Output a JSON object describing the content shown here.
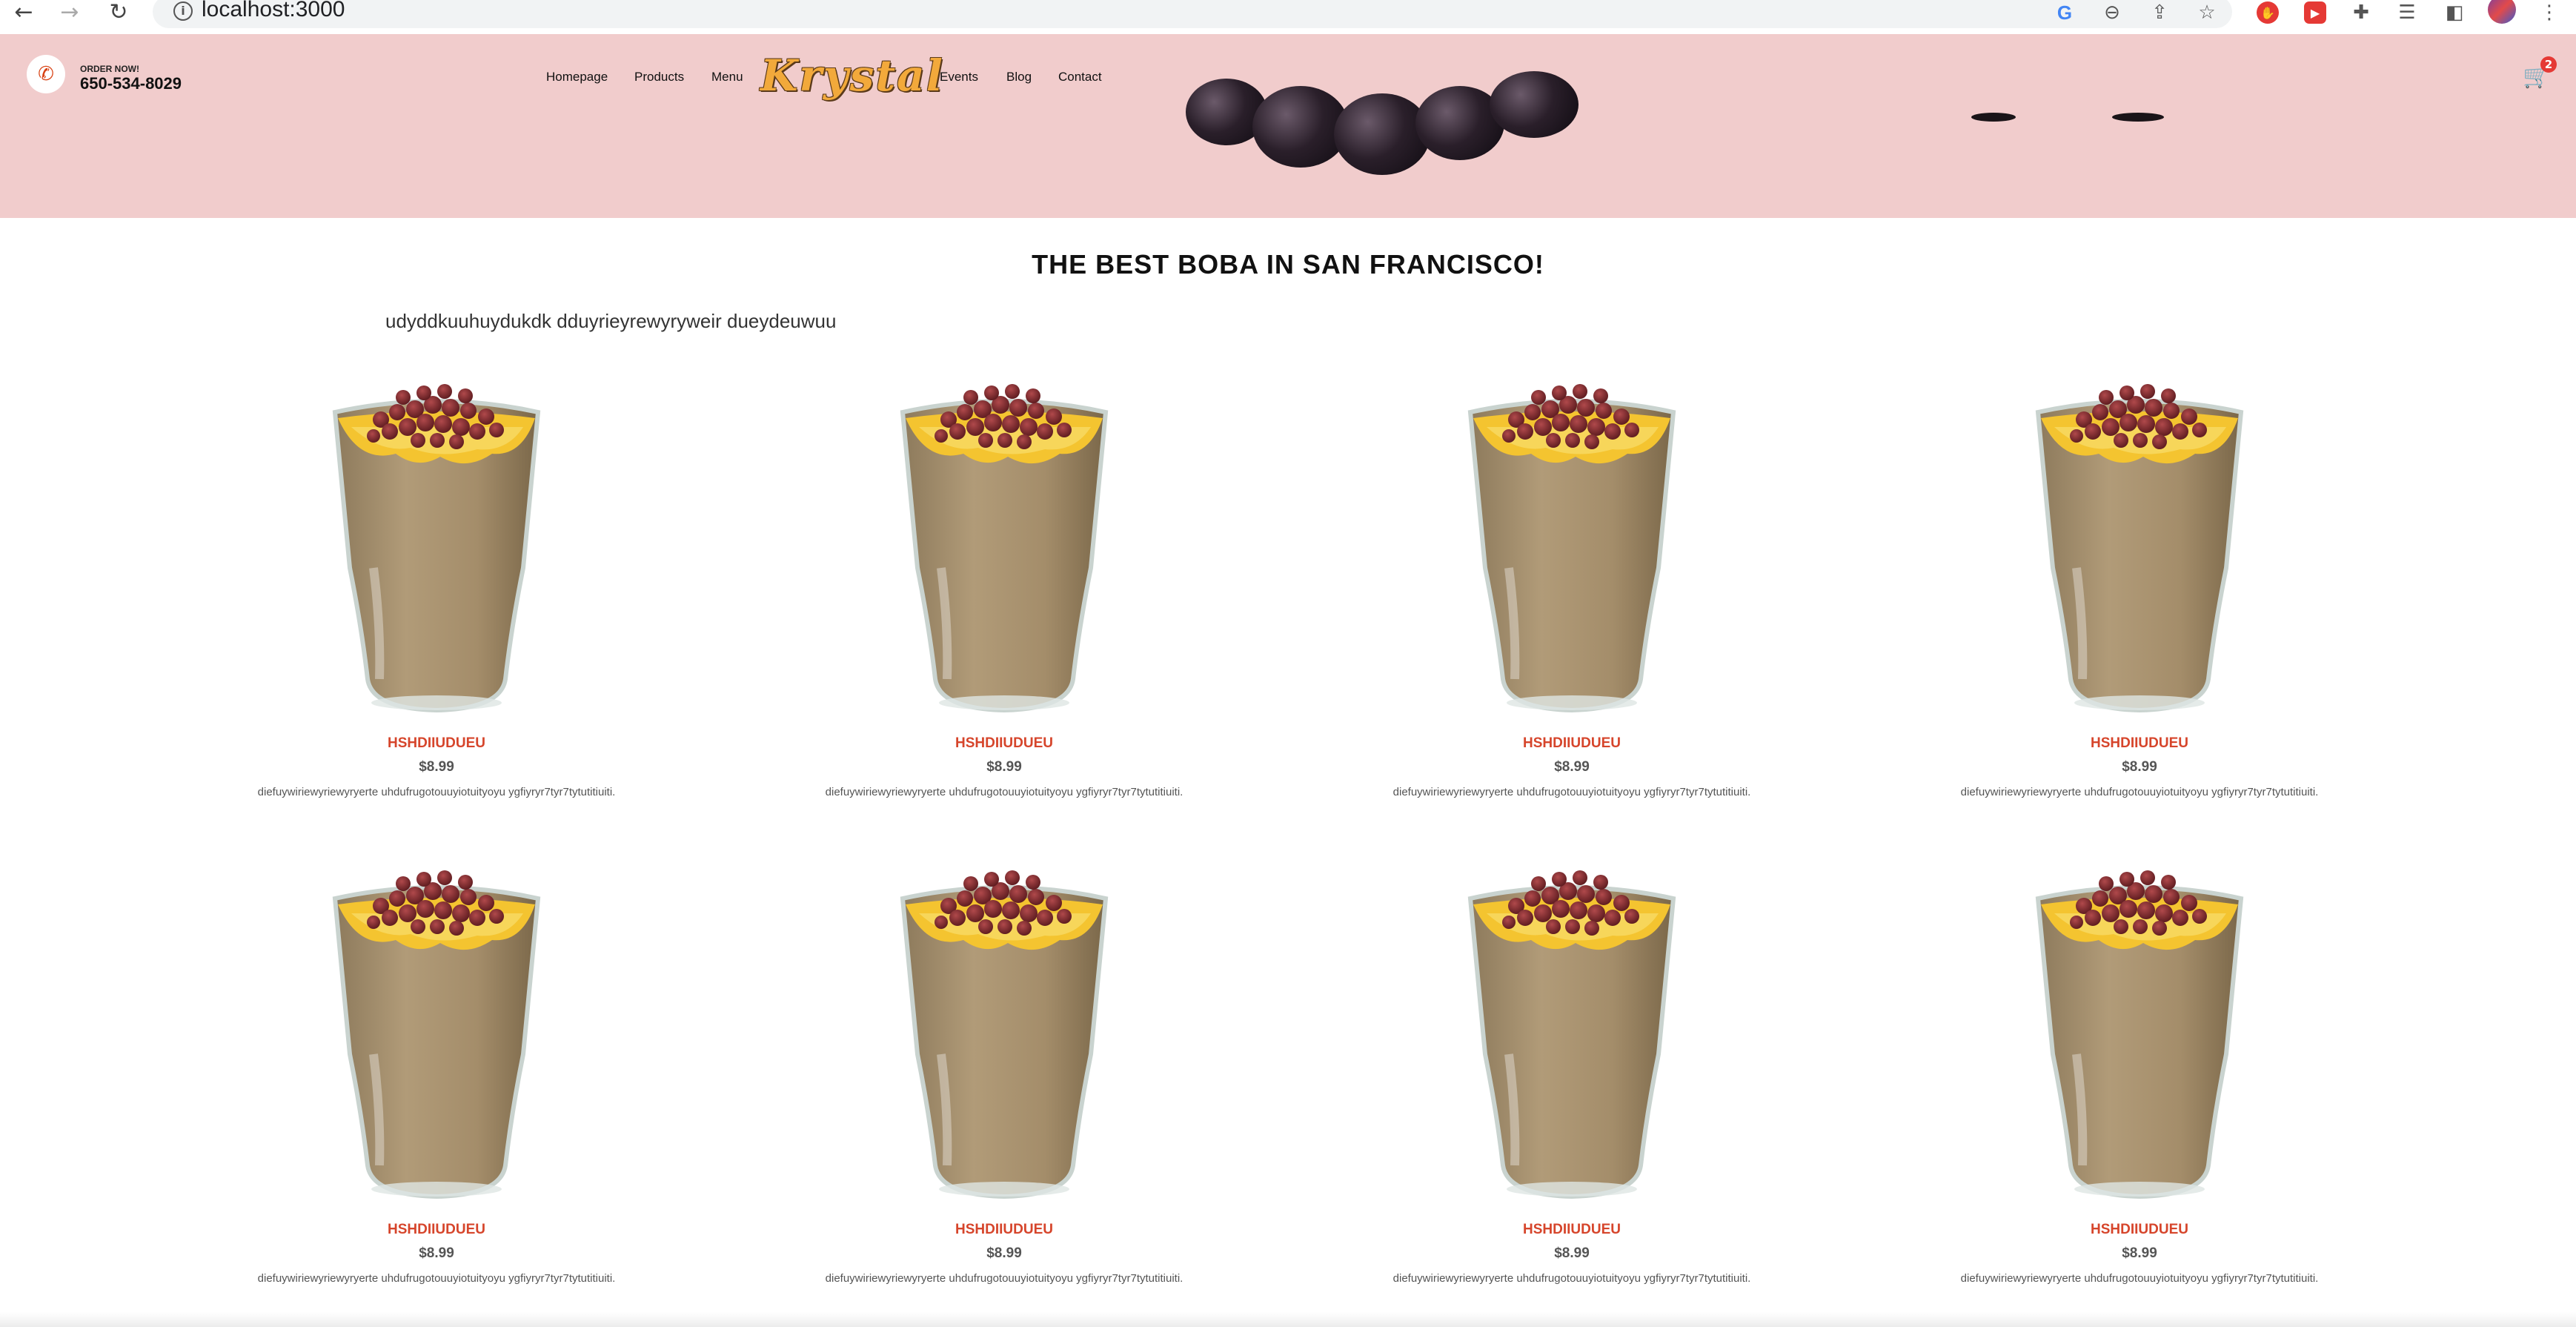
{
  "browser": {
    "url": "localhost:3000",
    "icons": [
      "back-icon",
      "forward-icon",
      "reload-icon",
      "info-icon",
      "google-icon",
      "zoom-out-icon",
      "share-icon",
      "star-icon",
      "extension-red-icon",
      "youtube-extension-icon",
      "puzzle-extensions-icon",
      "reading-list-icon",
      "side-panel-icon",
      "profile-avatar",
      "more-menu-icon"
    ]
  },
  "header": {
    "order_label": "ORDER NOW!",
    "phone": "650-534-8029",
    "nav": [
      "Homepage",
      "Products",
      "Menu",
      "Events",
      "Blog",
      "Contact"
    ],
    "logo": "Krystal",
    "cart_count": "2",
    "background": "#f1cccc"
  },
  "main": {
    "headline": "THE BEST BOBA IN SAN FRANCISCO!",
    "intro": "udyddkuuhuydukdk dduyrieyrewyryweir dueydeuwuu",
    "products": [
      {
        "name": "HSHDIIUDUEU",
        "price": "$8.99",
        "desc": "diefuywiriewyriewyryerte uhdufrugotouuyiotuityoyu ygfiyryr7tyr7tytutitiuiti."
      },
      {
        "name": "HSHDIIUDUEU",
        "price": "$8.99",
        "desc": "diefuywiriewyriewyryerte uhdufrugotouuyiotuityoyu ygfiyryr7tyr7tytutitiuiti."
      },
      {
        "name": "HSHDIIUDUEU",
        "price": "$8.99",
        "desc": "diefuywiriewyriewyryerte uhdufrugotouuyiotuityoyu ygfiyryr7tyr7tytutitiuiti."
      },
      {
        "name": "HSHDIIUDUEU",
        "price": "$8.99",
        "desc": "diefuywiriewyriewyryerte uhdufrugotouuyiotuityoyu ygfiyryr7tyr7tytutitiuiti."
      },
      {
        "name": "HSHDIIUDUEU",
        "price": "$8.99",
        "desc": "diefuywiriewyriewyryerte uhdufrugotouuyiotuityoyu ygfiyryr7tyr7tytutitiuiti."
      },
      {
        "name": "HSHDIIUDUEU",
        "price": "$8.99",
        "desc": "diefuywiriewyriewyryerte uhdufrugotouuyiotuityoyu ygfiyryr7tyr7tytutitiuiti."
      },
      {
        "name": "HSHDIIUDUEU",
        "price": "$8.99",
        "desc": "diefuywiriewyriewyryerte uhdufrugotouuyiotuityoyu ygfiyryr7tyr7tytutitiuiti."
      },
      {
        "name": "HSHDIIUDUEU",
        "price": "$8.99",
        "desc": "diefuywiriewyriewyryerte uhdufrugotouuyiotuityoyu ygfiyryr7tyr7tytutitiuiti."
      }
    ]
  },
  "colors": {
    "product_name": "#d6452b",
    "logo": "#f2a93b"
  }
}
